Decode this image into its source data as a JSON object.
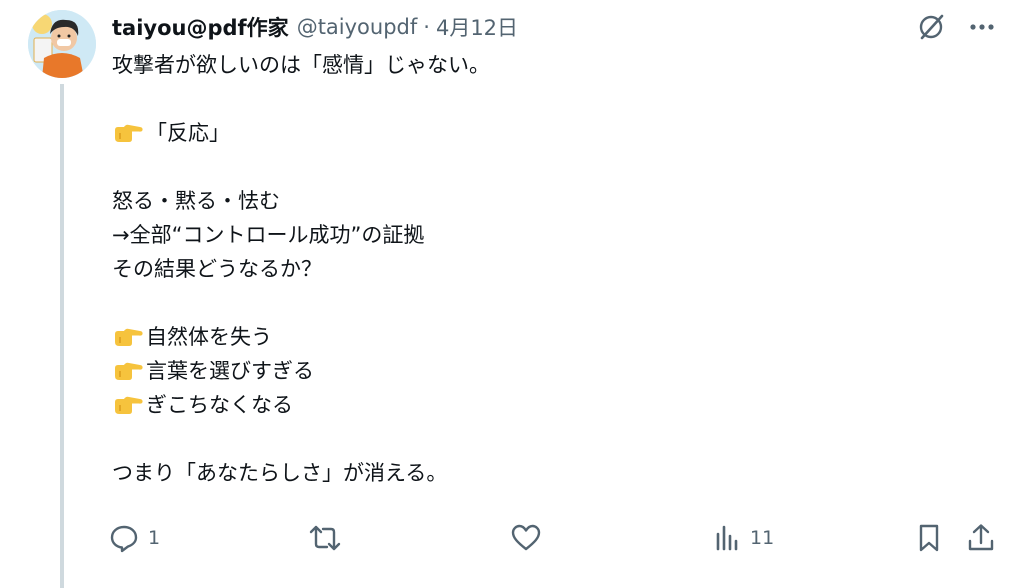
{
  "post": {
    "display_name": "taiyou@pdf作家",
    "handle": "@taiyoupdf",
    "separator": "·",
    "date": "4月12日"
  },
  "body_lines": [
    {
      "text": "攻撃者が欲しいのは「感情」じゃない。",
      "emoji": null
    },
    {
      "text": "",
      "emoji": null
    },
    {
      "text": "「反応」",
      "emoji": "backhand-index-pointing-right"
    },
    {
      "text": "",
      "emoji": null
    },
    {
      "text": "怒る・黙る・怯む",
      "emoji": null
    },
    {
      "text": "→全部“コントロール成功”の証拠",
      "emoji": null
    },
    {
      "text": "その結果どうなるか？",
      "emoji": null
    },
    {
      "text": "",
      "emoji": null
    },
    {
      "text": "自然体を失う",
      "emoji": "backhand-index-pointing-right"
    },
    {
      "text": "言葉を選びすぎる",
      "emoji": "backhand-index-pointing-right"
    },
    {
      "text": "ぎこちなくなる",
      "emoji": "backhand-index-pointing-right"
    },
    {
      "text": "",
      "emoji": null
    },
    {
      "text": "つまり「あなたらしさ」が消える。",
      "emoji": null
    }
  ],
  "actions": {
    "reply_count": "1",
    "retweet_count": "",
    "like_count": "",
    "views_count": "11"
  },
  "icons": {
    "top_right": [
      "grok-icon",
      "more-icon"
    ],
    "action_bar": [
      "reply-icon",
      "retweet-icon",
      "like-icon",
      "views-icon",
      "bookmark-icon",
      "share-icon"
    ]
  },
  "colors": {
    "text": "#0f1419",
    "secondary": "#536471",
    "thread_line": "#cfd9de",
    "emoji_yellow": "#f6c33d"
  }
}
